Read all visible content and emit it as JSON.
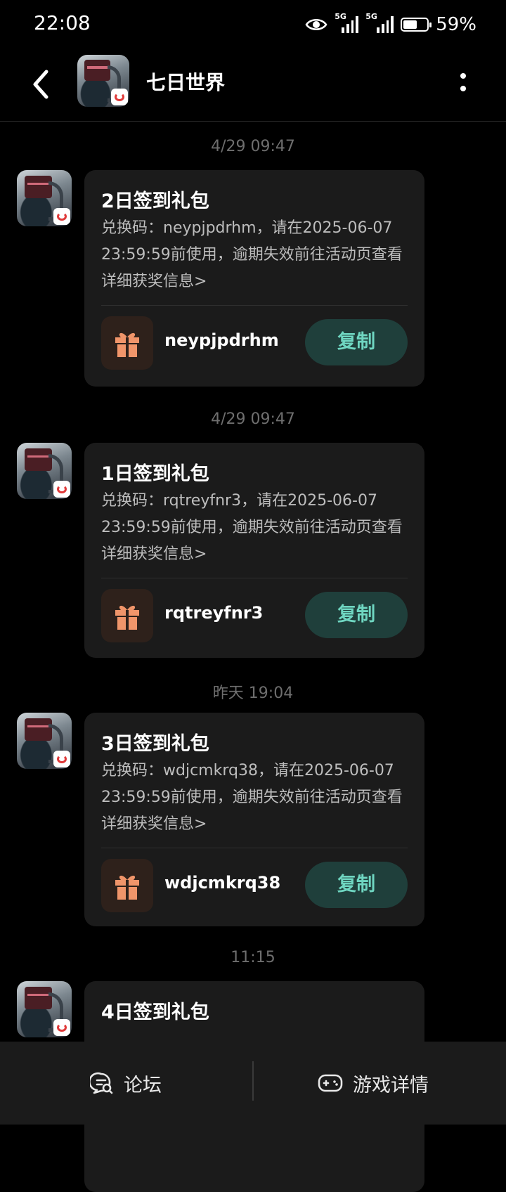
{
  "status_bar": {
    "time": "22:08",
    "signal1_label": "5G",
    "signal2_label": "5G",
    "battery_percent": "59%",
    "battery_level": 0.59,
    "icons": [
      "eye-icon",
      "signal-icon",
      "signal-icon",
      "battery-charging-icon"
    ]
  },
  "header": {
    "title": "七日世界",
    "back_icon": "chevron-left-icon",
    "more_icon": "more-vertical-icon"
  },
  "messages": [
    {
      "time": "4/29  09:47",
      "title": "2日签到礼包",
      "desc": "兑换码：neypjpdrhm，请在2025-06-07 23:59:59前使用，逾期失效前往活动页查看详细获奖信息>",
      "code": "neypjpdrhm",
      "copy_label": "复制"
    },
    {
      "time": "4/29  09:47",
      "title": "1日签到礼包",
      "desc": "兑换码：rqtreyfnr3，请在2025-06-07 23:59:59前使用，逾期失效前往活动页查看详细获奖信息>",
      "code": "rqtreyfnr3",
      "copy_label": "复制"
    },
    {
      "time": "昨天  19:04",
      "title": "3日签到礼包",
      "desc": "兑换码：wdjcmkrq38，请在2025-06-07 23:59:59前使用，逾期失效前往活动页查看详细获奖信息>",
      "code": "wdjcmkrq38",
      "copy_label": "复制"
    },
    {
      "time": "11:15",
      "title": "4日签到礼包"
    }
  ],
  "bottom_bar": {
    "forum_label": "论坛",
    "game_details_label": "游戏详情"
  },
  "colors": {
    "background": "#000000",
    "card": "#1b1b1b",
    "copy_button_bg": "#1f3f3b",
    "copy_button_text": "#6fd6c1",
    "gift_icon": "#f0956a"
  }
}
